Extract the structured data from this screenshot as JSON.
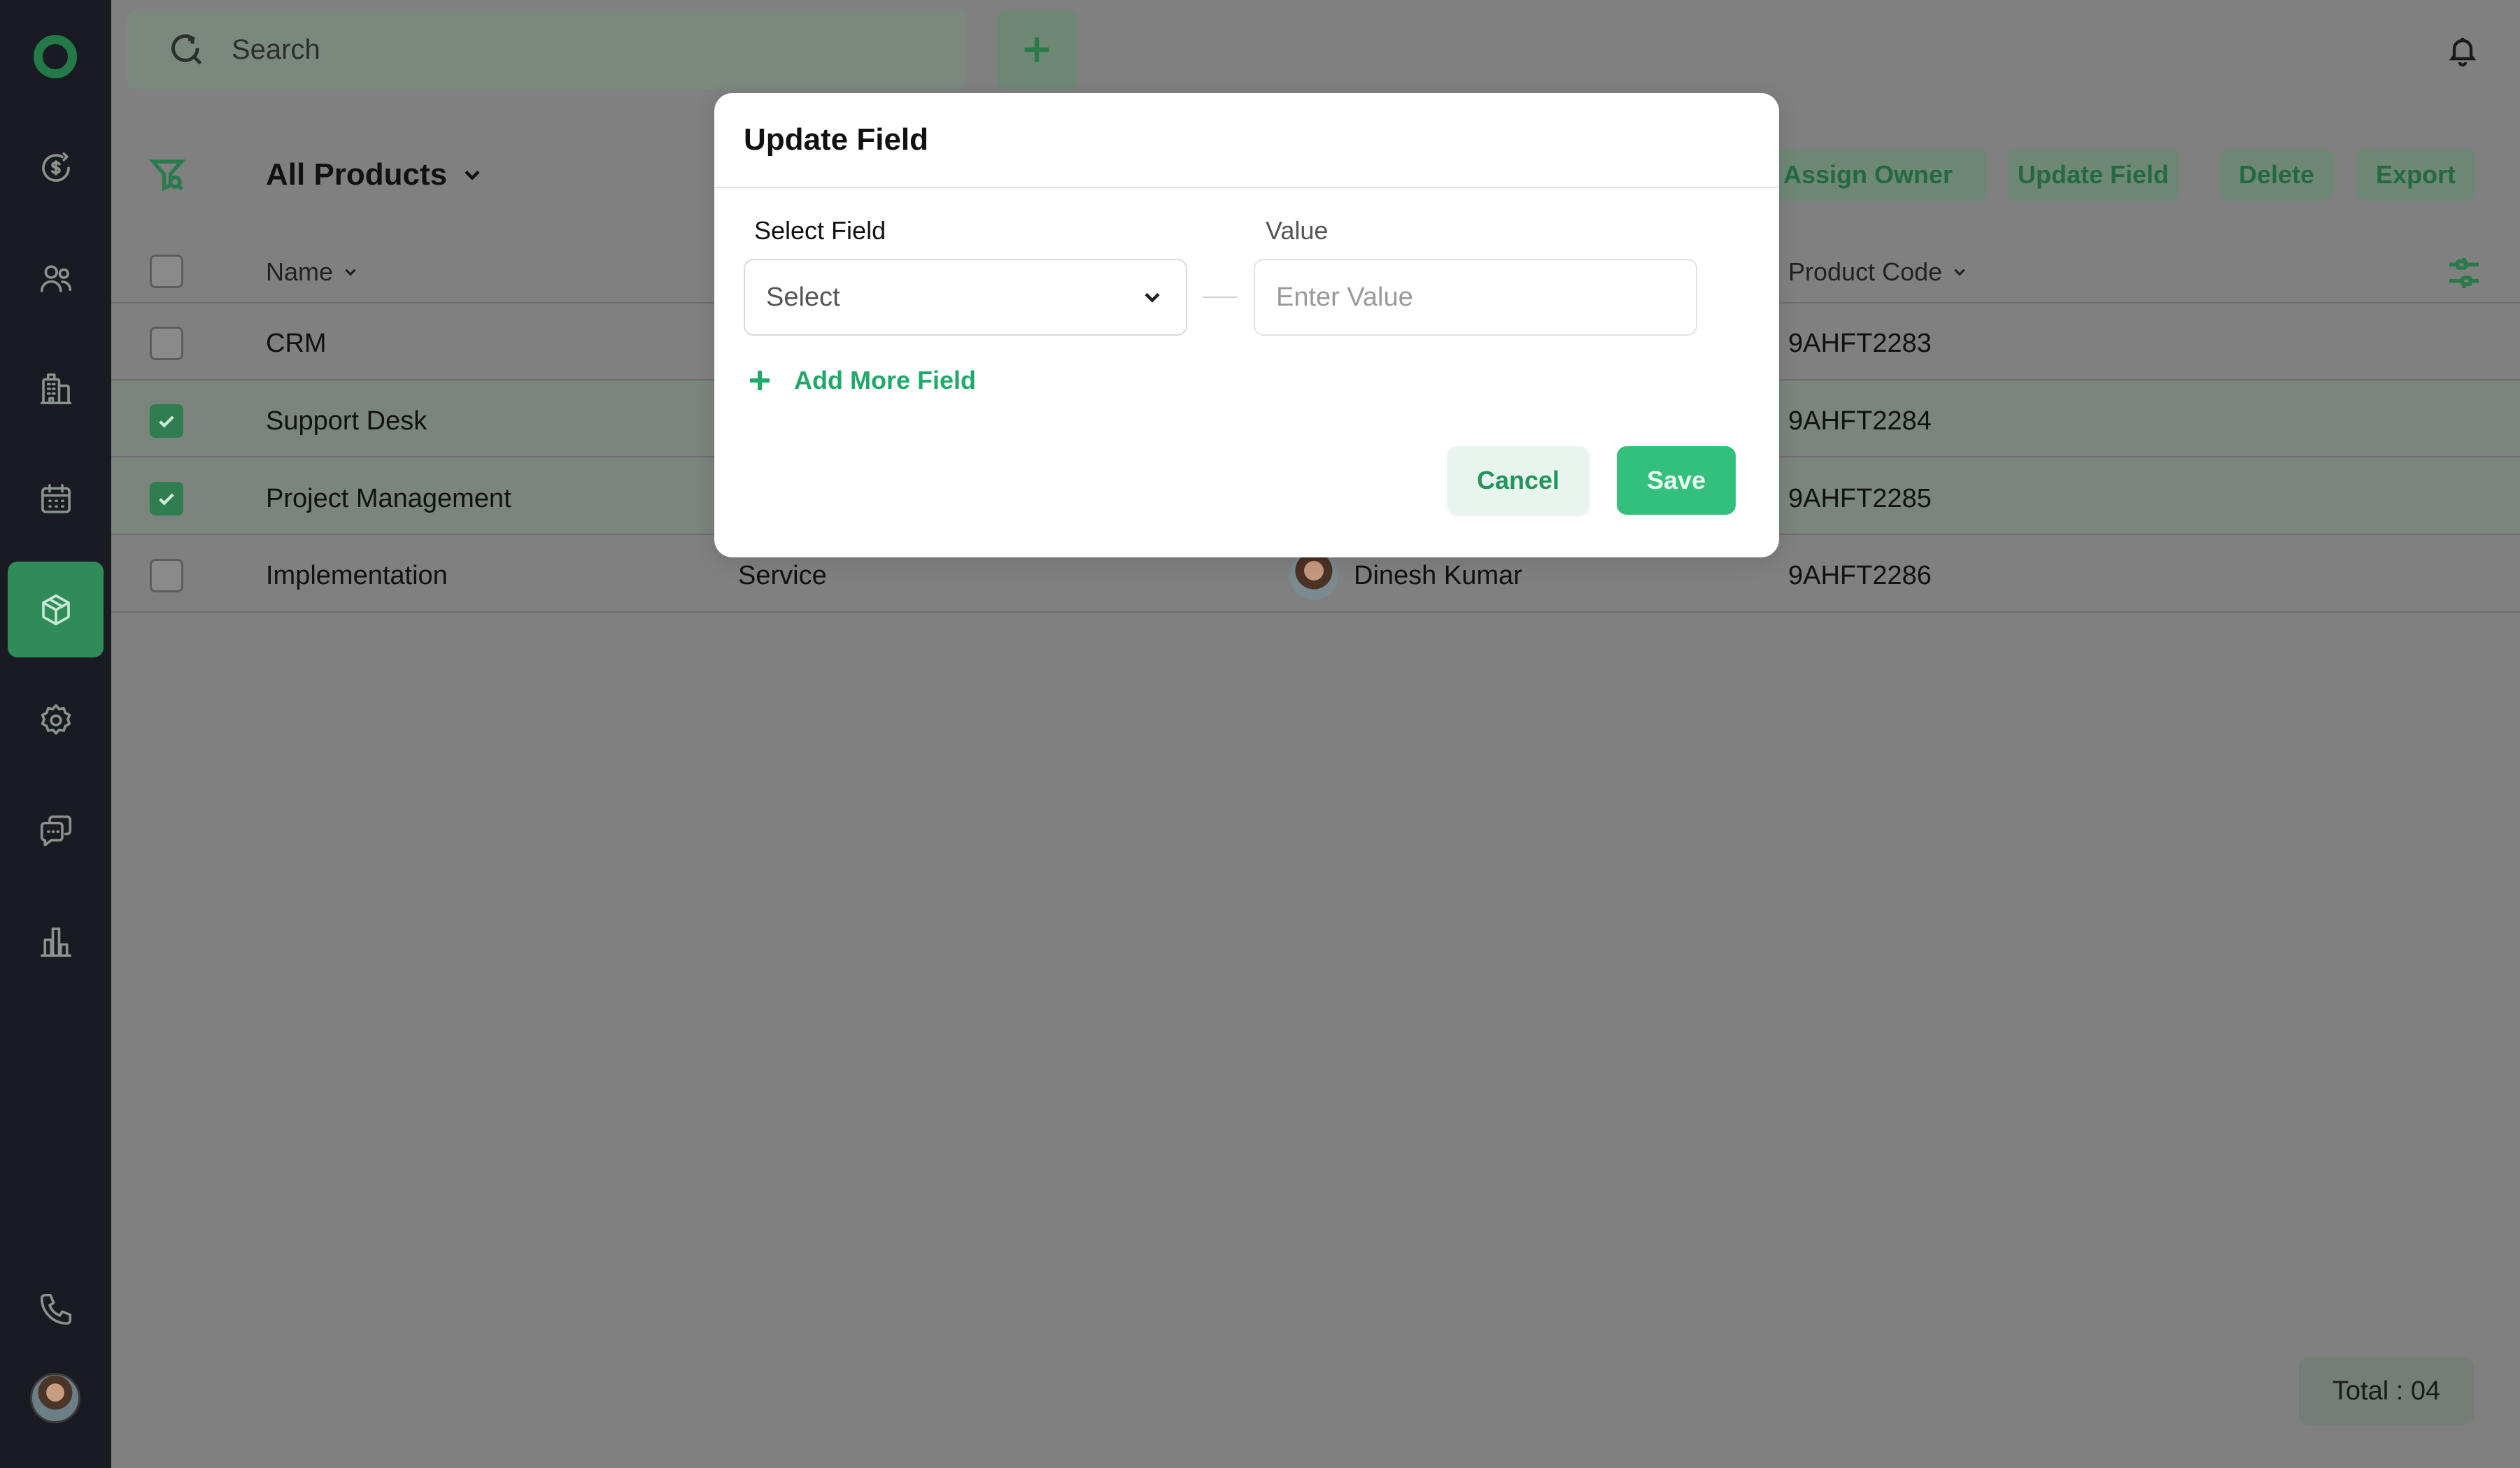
{
  "sidebar": {
    "items": [
      {
        "name": "deals-icon"
      },
      {
        "name": "contacts-icon"
      },
      {
        "name": "companies-icon"
      },
      {
        "name": "calendar-icon"
      },
      {
        "name": "products-icon",
        "active": true
      },
      {
        "name": "settings-icon"
      },
      {
        "name": "chat-icon"
      },
      {
        "name": "reports-icon"
      }
    ],
    "bottom": [
      {
        "name": "phone-icon"
      },
      {
        "name": "user-avatar"
      }
    ]
  },
  "topbar": {
    "search_placeholder": "Search",
    "add_icon": "plus-icon",
    "bell_icon": "bell-icon"
  },
  "toolbar": {
    "view_title": "All Products",
    "actions": {
      "assign_owner": "Assign Owner",
      "update_field": "Update Field",
      "delete": "Delete",
      "export": "Export"
    }
  },
  "table": {
    "headers": {
      "name": "Name",
      "product_code": "Product Code"
    },
    "rows": [
      {
        "name": "CRM",
        "type": "",
        "owner": "",
        "code": "9AHFT2283",
        "checked": false
      },
      {
        "name": "Support Desk",
        "type": "",
        "owner": "",
        "code": "9AHFT2284",
        "checked": true
      },
      {
        "name": "Project Management",
        "type": "",
        "owner": "",
        "code": "9AHFT2285",
        "checked": true
      },
      {
        "name": "Implementation",
        "type": "Service",
        "owner": "Dinesh Kumar",
        "code": "9AHFT2286",
        "checked": false
      }
    ],
    "total": "Total : 04"
  },
  "modal": {
    "title": "Update Field",
    "select_label": "Select Field",
    "select_value": "Select",
    "value_label": "Value",
    "value_placeholder": "Enter Value",
    "add_more": "Add More Field",
    "cancel": "Cancel",
    "save": "Save"
  },
  "colors": {
    "accent": "#33c07d",
    "accent_dark": "#2a7a4c",
    "sidebar_bg": "#1a1b22",
    "overlay": "#808080"
  }
}
